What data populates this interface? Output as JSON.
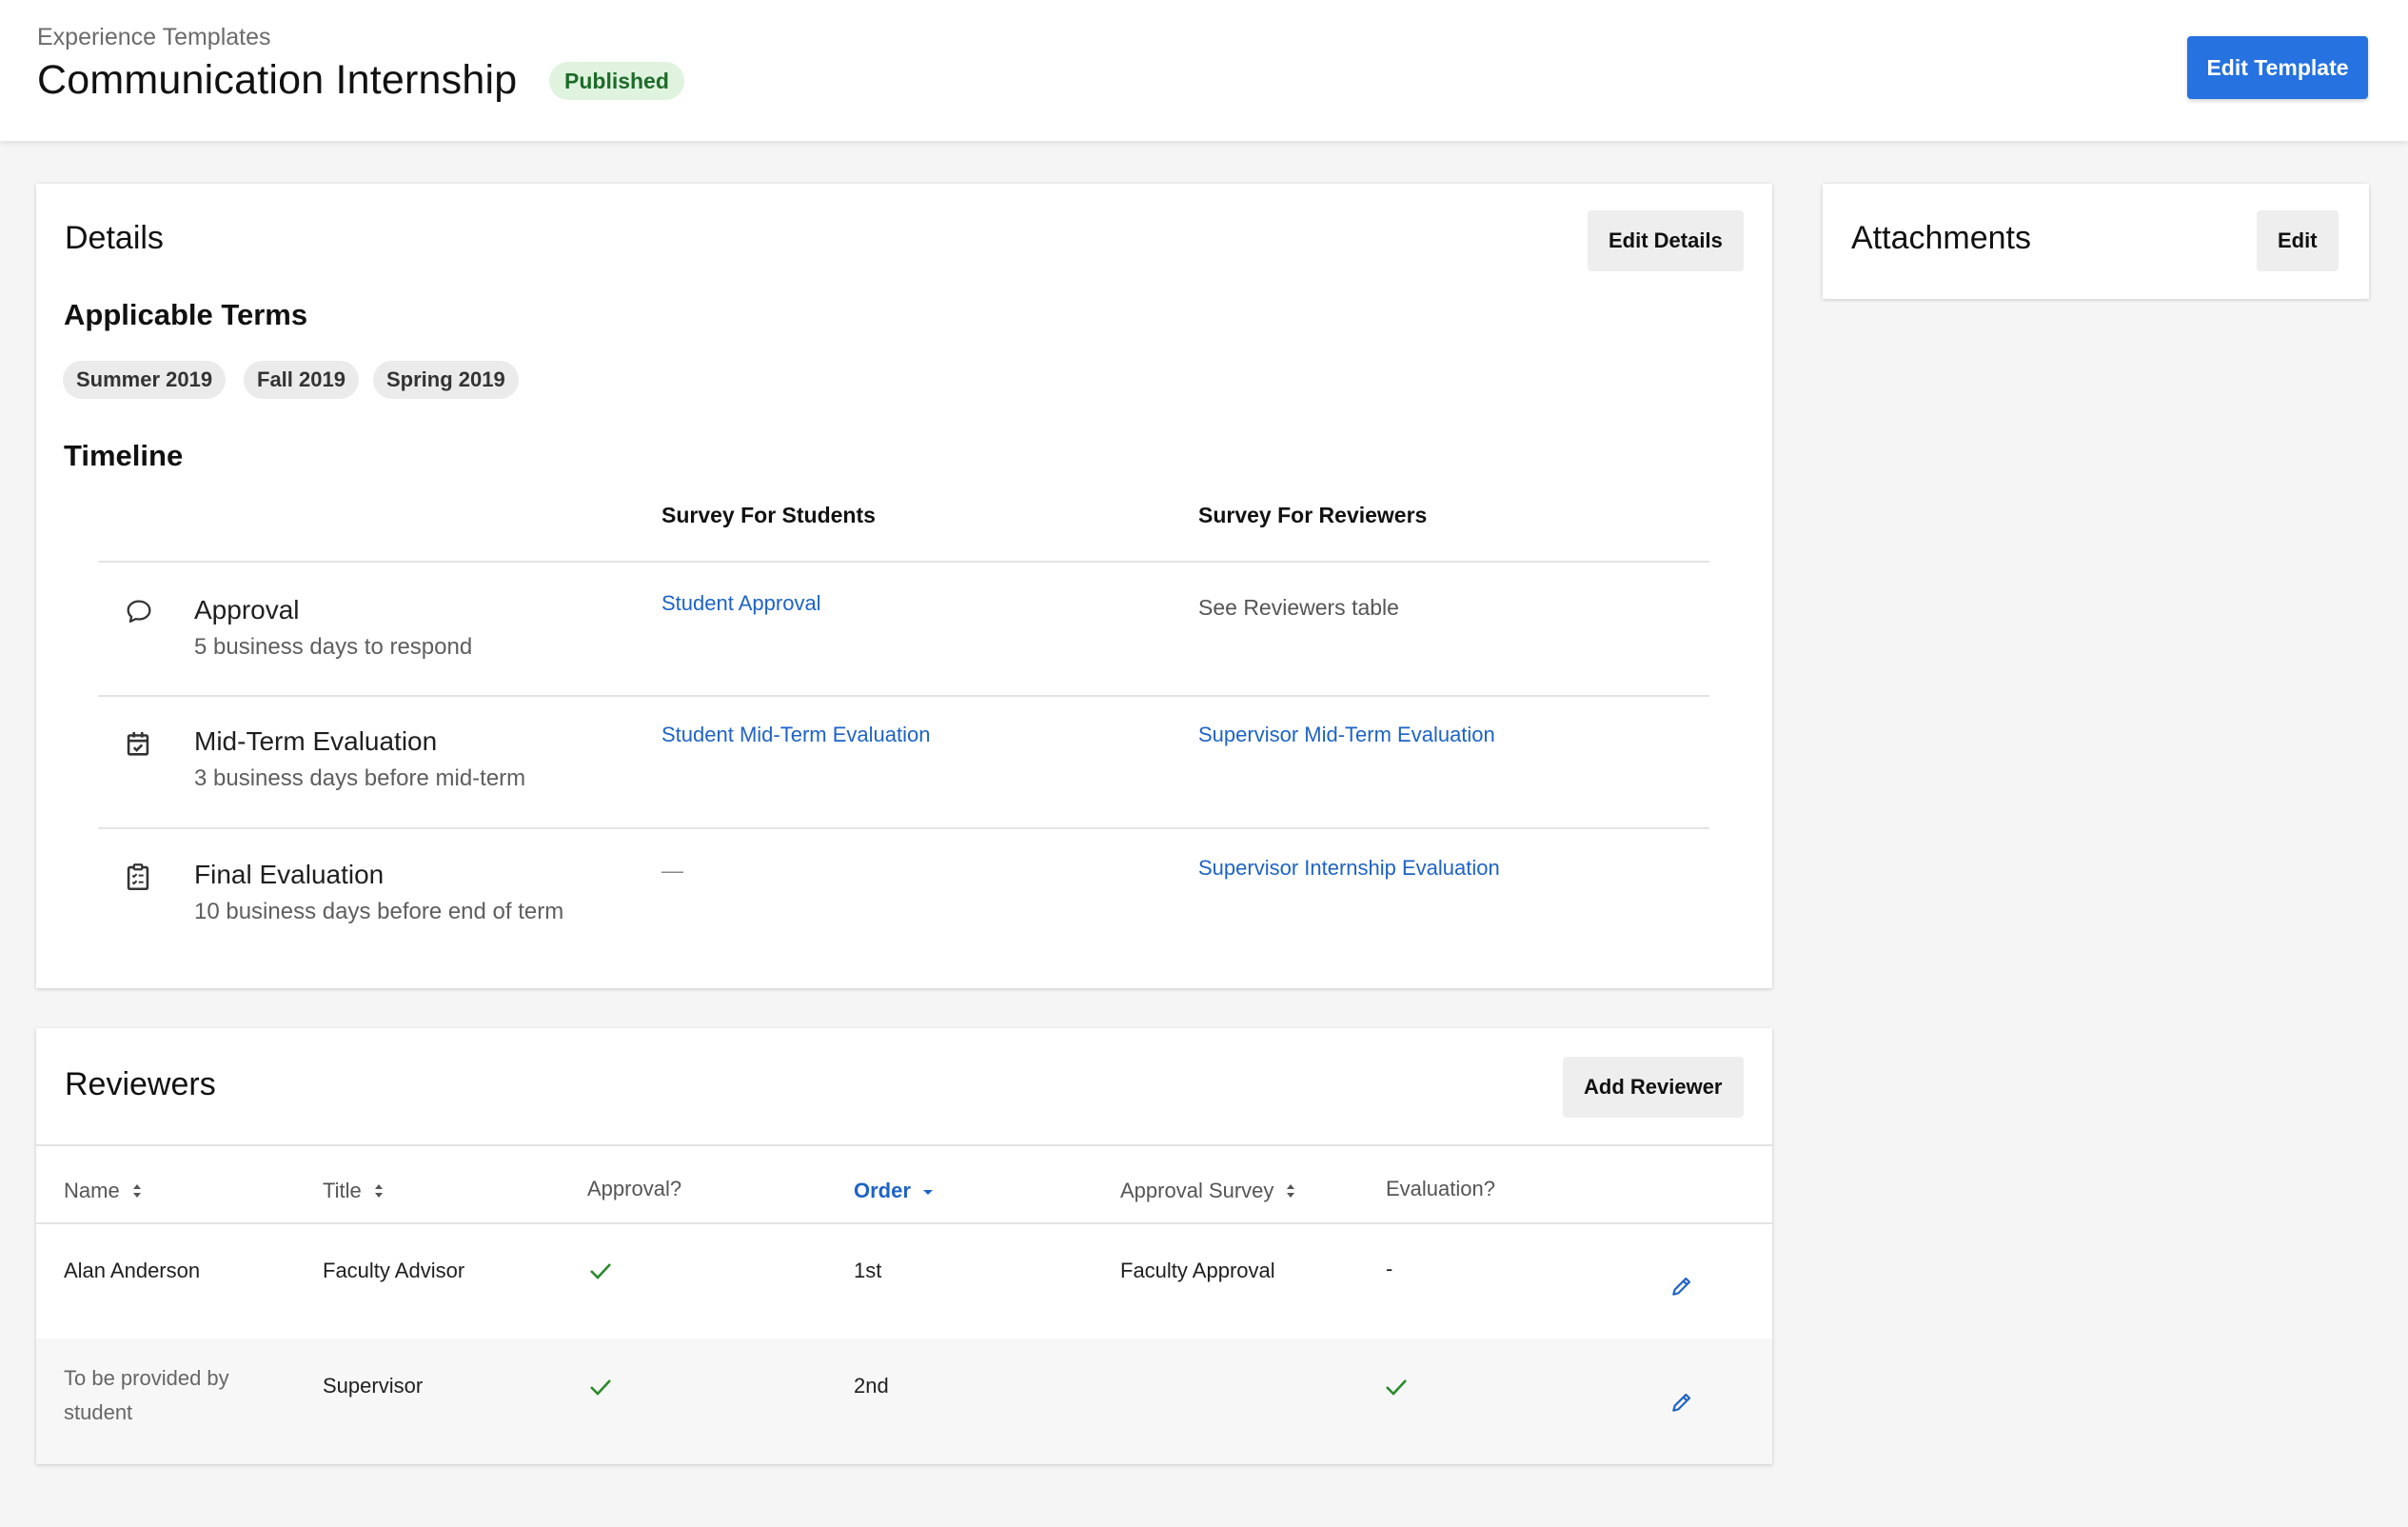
{
  "header": {
    "breadcrumb": "Experience Templates",
    "title": "Communication Internship",
    "status": "Published",
    "edit_template_label": "Edit Template"
  },
  "details": {
    "title": "Details",
    "edit_label": "Edit Details",
    "terms_heading": "Applicable Terms",
    "terms": [
      "Summer 2019",
      "Fall 2019",
      "Spring 2019"
    ],
    "timeline_heading": "Timeline",
    "timeline_columns": [
      "Survey For Students",
      "Survey For Reviewers"
    ],
    "timeline": [
      {
        "icon": "chat-bubble-icon",
        "name": "Approval",
        "sub": "5 business days to respond",
        "student_survey": "Student Approval",
        "reviewer_survey": "See Reviewers table"
      },
      {
        "icon": "calendar-check-icon",
        "name": "Mid-Term Evaluation",
        "sub": "3 business days before mid-term",
        "student_survey": "Student Mid-Term Evaluation",
        "reviewer_survey": "Supervisor Mid-Term Evaluation"
      },
      {
        "icon": "clipboard-checklist-icon",
        "name": "Final Evaluation",
        "sub": "10 business days before end of term",
        "student_survey": "—",
        "reviewer_survey": "Supervisor Internship Evaluation"
      }
    ]
  },
  "attachments": {
    "title": "Attachments",
    "edit_label": "Edit"
  },
  "reviewers": {
    "title": "Reviewers",
    "add_label": "Add Reviewer",
    "columns": [
      "Name",
      "Title",
      "Approval?",
      "Order",
      "Approval Survey",
      "Evaluation?"
    ],
    "rows": [
      {
        "name": "Alan Anderson",
        "title": "Faculty Advisor",
        "approval": "check-icon",
        "order": "1st",
        "approval_survey": "Faculty Approval",
        "evaluation": "-"
      },
      {
        "name": "To be provided by student",
        "title": "Supervisor",
        "approval": "check-icon",
        "order": "2nd",
        "approval_survey": "",
        "evaluation": "check-icon"
      }
    ]
  },
  "colors": {
    "primary": "#2572e0",
    "link": "#1e63c6",
    "badge_bg": "#dff3df",
    "badge_text": "#1f6b2a",
    "check": "#2a8a2a"
  }
}
